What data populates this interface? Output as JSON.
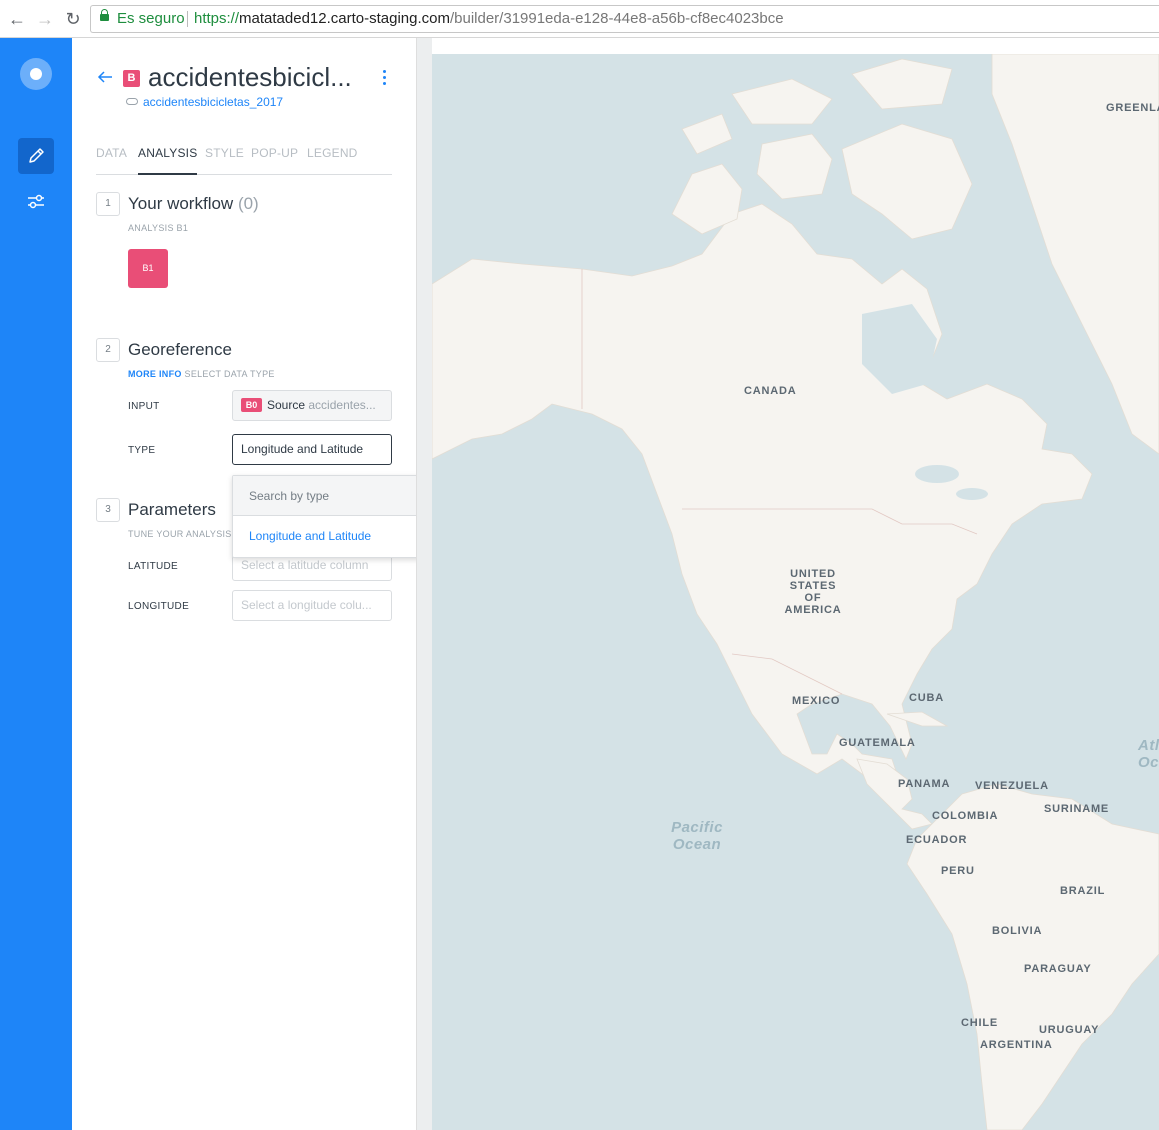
{
  "browser": {
    "secure_label": "Es seguro",
    "url_protocol": "https://",
    "url_host": "matataded12.carto-staging.com",
    "url_path": "/builder/31991eda-e128-44e8-a56b-cf8ec4023bce"
  },
  "layer": {
    "badge": "B",
    "title": "accidentesbicicl...",
    "dataset": "accidentesbicicletas_2017"
  },
  "tabs": [
    {
      "label": "DATA",
      "active": false
    },
    {
      "label": "ANALYSIS",
      "active": true
    },
    {
      "label": "STYLE",
      "active": false
    },
    {
      "label": "POP-UP",
      "active": false
    },
    {
      "label": "LEGEND",
      "active": false
    }
  ],
  "workflow": {
    "number": "1",
    "title": "Your workflow",
    "count": "(0)",
    "subtitle": "ANALYSIS B1",
    "node": "B1"
  },
  "georeference": {
    "number": "2",
    "title": "Georeference",
    "more_info": "MORE INFO",
    "subtitle": "SELECT DATA TYPE",
    "input_label": "INPUT",
    "input_badge": "B0",
    "input_source": "Source",
    "input_name": "accidentes...",
    "type_label": "TYPE",
    "type_value": "Longitude and Latitude"
  },
  "dropdown": {
    "search_placeholder": "Search by type",
    "options": [
      "Longitude and Latitude"
    ]
  },
  "parameters": {
    "number": "3",
    "title": "Parameters",
    "subtitle": "TUNE YOUR ANALYSIS",
    "latitude_label": "LATITUDE",
    "latitude_placeholder": "Select a latitude column",
    "longitude_label": "LONGITUDE",
    "longitude_placeholder": "Select a longitude colu..."
  },
  "map": {
    "labels": [
      "GREENLA",
      "CANADA",
      "UNITED STATES OF AMERICA",
      "MEXICO",
      "CUBA",
      "GUATEMALA",
      "PANAMA",
      "VENEZUELA",
      "SURINAME",
      "COLOMBIA",
      "ECUADOR",
      "PERU",
      "BRAZIL",
      "BOLIVIA",
      "PARAGUAY",
      "CHILE",
      "URUGUAY",
      "ARGENTINA"
    ],
    "ocean_labels": [
      "Pacific Ocean",
      "Atl Oc"
    ],
    "water_color": "#d4e2e6",
    "land_color": "#f6f4f0"
  },
  "colors": {
    "accent": "#1e85f8",
    "layer": "#e94e77",
    "text": "#2f3a45"
  }
}
